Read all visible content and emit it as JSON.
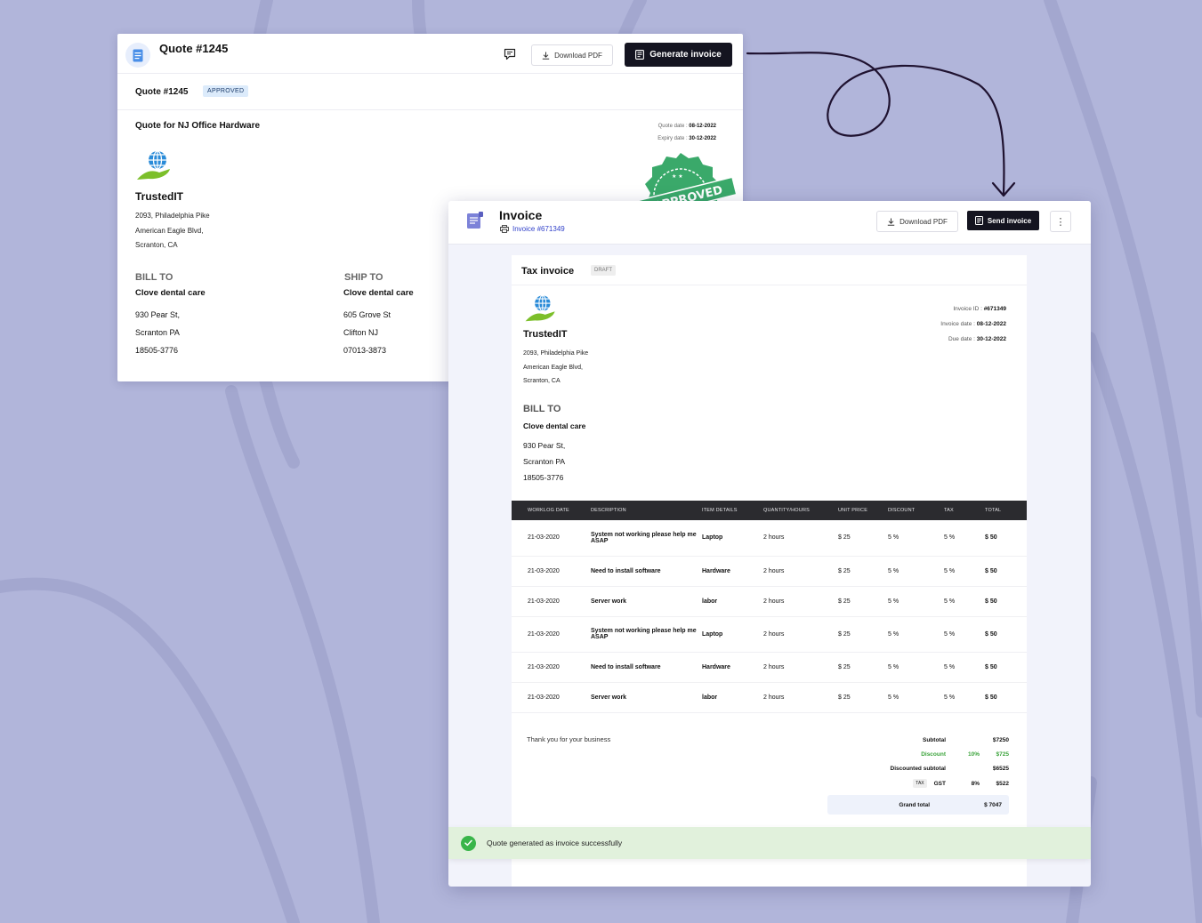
{
  "quote": {
    "window_title": "Quote #1245",
    "download_label": "Download PDF",
    "generate_label": "Generate invoice",
    "sub_title": "Quote #1245",
    "status_badge": "APPROVED",
    "heading": "Quote for NJ Office Hardware",
    "quote_date_label": "Quote date : ",
    "quote_date": "08-12-2022",
    "expiry_date_label": "Expiry date : ",
    "expiry_date": "30-12-2022",
    "company": "TrustedIT",
    "address": [
      "2093, Philadelphia Pike",
      "American Eagle Blvd,",
      "Scranton, CA"
    ],
    "bill_to": {
      "heading": "BILL TO",
      "name": "Clove dental care",
      "address": [
        "930 Pear St,",
        "Scranton PA",
        "18505-3776"
      ]
    },
    "ship_to": {
      "heading": "SHIP TO",
      "name": "Clove dental care",
      "address": [
        "605 Grove St",
        "Clifton NJ",
        "07013-3873"
      ]
    },
    "stamp_text": "APPROVED"
  },
  "invoice": {
    "window_title": "Invoice",
    "invoice_link": "Invoice #671349",
    "download_label": "Download PDF",
    "send_label": "Send invoice",
    "more_icon": "⋮",
    "doc_title": "Tax invoice",
    "doc_status": "DRAFT",
    "company": "TrustedIT",
    "address": [
      "2093, Philadelphia Pike",
      "American Eagle Blvd,",
      "Scranton, CA"
    ],
    "invoice_id_label": "Invoice ID : ",
    "invoice_id": "#671349",
    "invoice_date_label": "Invoice date : ",
    "invoice_date": "08-12-2022",
    "due_date_label": "Due date : ",
    "due_date": "30-12-2022",
    "bill_to": {
      "heading": "BILL TO",
      "name": "Clove dental care",
      "address": [
        "930 Pear St,",
        "Scranton PA",
        "18505-3776"
      ]
    },
    "table": {
      "headers": [
        "WORKLOG DATE",
        "DESCRIPTION",
        "ITEM DETAILS",
        "QUANTITY/HOURS",
        "UNIT PRICE",
        "DISCOUNT",
        "TAX",
        "TOTAL"
      ],
      "rows": [
        [
          "21-03-2020",
          "System not working please help me ASAP",
          "Laptop",
          "2 hours",
          "$ 25",
          "5 %",
          "5 %",
          "$ 50"
        ],
        [
          "21-03-2020",
          "Need to install software",
          "Hardware",
          "2 hours",
          "$ 25",
          "5 %",
          "5 %",
          "$ 50"
        ],
        [
          "21-03-2020",
          "Server work",
          "labor",
          "2 hours",
          "$ 25",
          "5 %",
          "5 %",
          "$ 50"
        ],
        [
          "21-03-2020",
          "System not working please help me ASAP",
          "Laptop",
          "2 hours",
          "$ 25",
          "5 %",
          "5 %",
          "$ 50"
        ],
        [
          "21-03-2020",
          "Need to install software",
          "Hardware",
          "2 hours",
          "$ 25",
          "5 %",
          "5 %",
          "$ 50"
        ],
        [
          "21-03-2020",
          "Server work",
          "labor",
          "2 hours",
          "$ 25",
          "5 %",
          "5 %",
          "$ 50"
        ]
      ]
    },
    "thanks": "Thank you for your business",
    "totals": {
      "subtotal_label": "Subtotal",
      "subtotal": "$7250",
      "discount_label": "Discount",
      "discount_pct": "10%",
      "discount": "$725",
      "discounted_label": "Discounted subtotal",
      "discounted": "$6525",
      "tax_chip": "TAX",
      "tax_label": "GST",
      "tax_pct": "8%",
      "tax": "$522",
      "grand_label": "Grand total",
      "grand": "$ 7047"
    },
    "toast": "Quote generated as invoice successfully"
  },
  "colors": {
    "background": "#b1b5da",
    "primary_button": "#141420",
    "link": "#2f3fc9",
    "success": "#39b54a",
    "stamp": "#3aa96a"
  }
}
